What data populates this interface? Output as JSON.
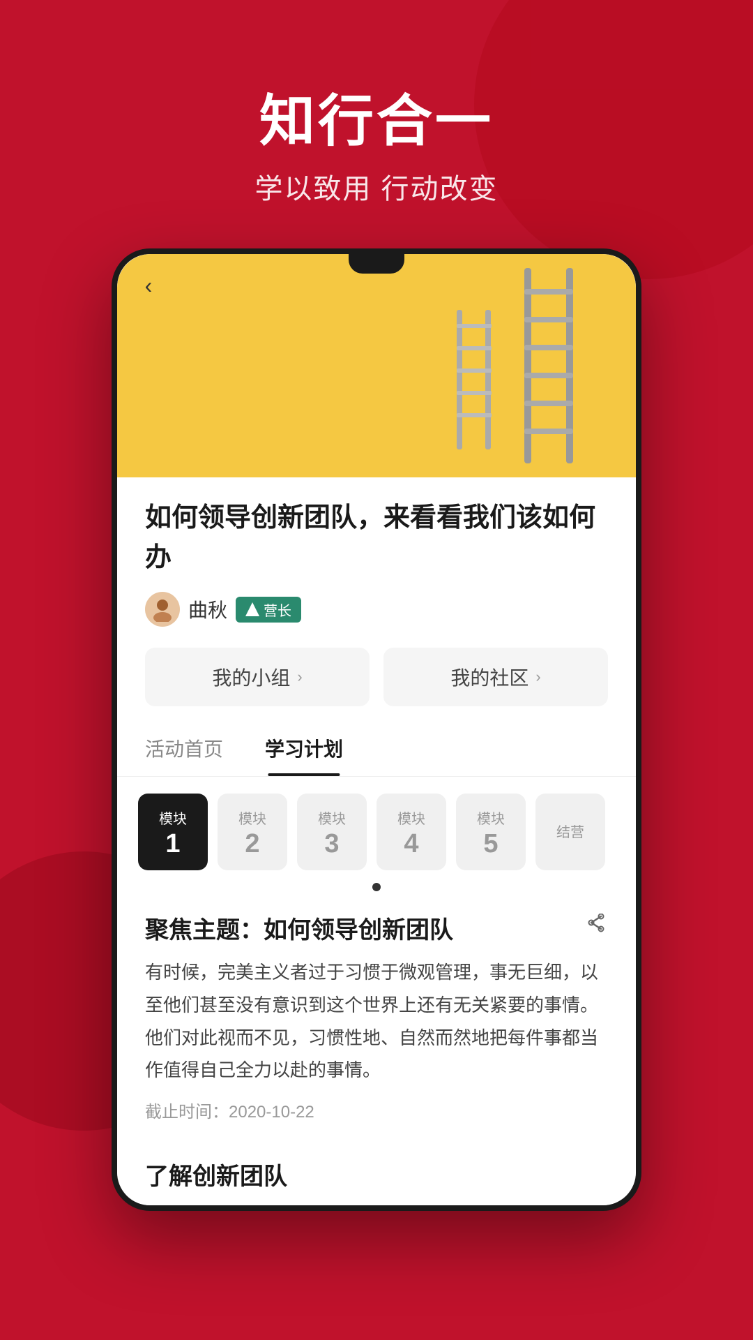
{
  "background": {
    "color": "#c0122c"
  },
  "header": {
    "title": "知行合一",
    "subtitle": "学以致用 行动改变"
  },
  "phone": {
    "back_button": "‹",
    "hero_alt": "Yellow wall with ladders"
  },
  "article": {
    "title": "如何领导创新团队，来看看我们该如何办",
    "author": {
      "name": "曲秋",
      "badge": "营长"
    },
    "nav": {
      "my_group": "我的小组",
      "my_community": "我的社区"
    },
    "tabs": [
      {
        "label": "活动首页",
        "active": false
      },
      {
        "label": "学习计划",
        "active": true
      }
    ],
    "modules": [
      {
        "label": "模块",
        "num": "1",
        "active": true
      },
      {
        "label": "模块",
        "num": "2",
        "active": false
      },
      {
        "label": "模块",
        "num": "3",
        "active": false
      },
      {
        "label": "模块",
        "num": "4",
        "active": false
      },
      {
        "label": "模块",
        "num": "5",
        "active": false
      },
      {
        "label": "结营",
        "num": "",
        "active": false
      }
    ],
    "focus": {
      "title": "聚焦主题：如何领导创新团队",
      "body": "有时候，完美主义者过于习惯于微观管理，事无巨细，以至他们甚至没有意识到这个世界上还有无关紧要的事情。他们对此视而不见，习惯性地、自然而然地把每件事都当作值得自己全力以赴的事情。",
      "deadline_label": "截止时间：",
      "deadline": "2020-10-22"
    },
    "sub_section_title": "了解创新团队"
  }
}
